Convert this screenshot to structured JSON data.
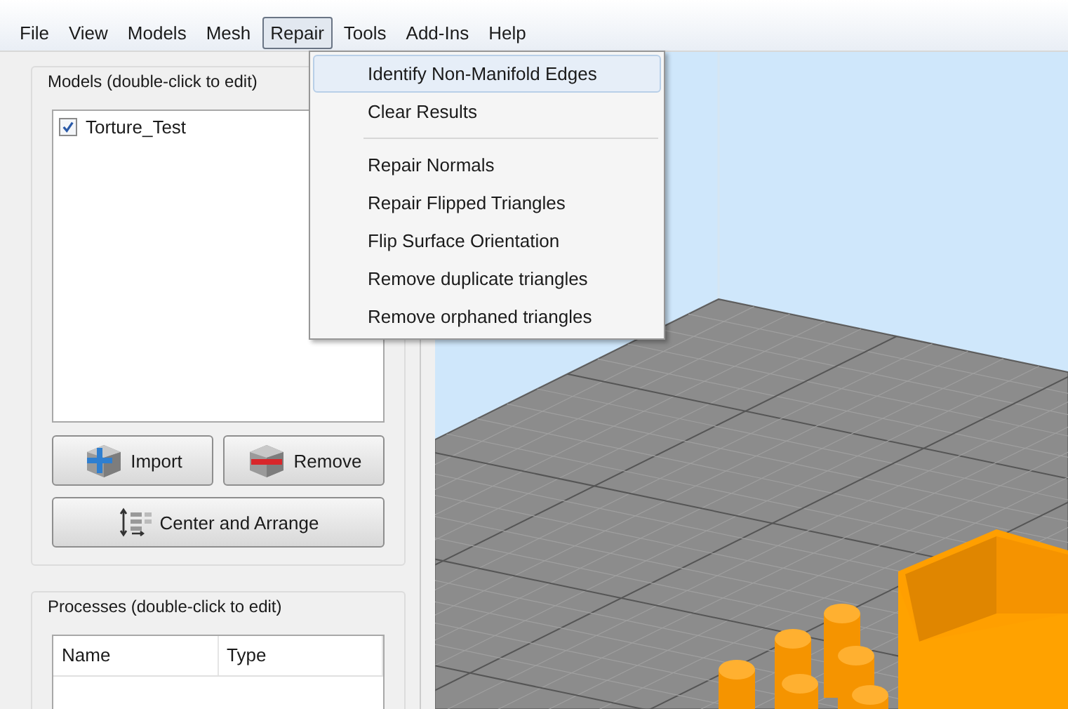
{
  "menu_bar": [
    {
      "label": "File",
      "selected": false
    },
    {
      "label": "View",
      "selected": false
    },
    {
      "label": "Models",
      "selected": false
    },
    {
      "label": "Mesh",
      "selected": false
    },
    {
      "label": "Repair",
      "selected": true
    },
    {
      "label": "Tools",
      "selected": false
    },
    {
      "label": "Add-Ins",
      "selected": false
    },
    {
      "label": "Help",
      "selected": false
    }
  ],
  "repair_menu": {
    "items": [
      {
        "kind": "item",
        "label": "Identify Non-Manifold Edges",
        "highlighted": true
      },
      {
        "kind": "item",
        "label": "Clear Results",
        "highlighted": false
      },
      {
        "kind": "separator"
      },
      {
        "kind": "item",
        "label": "Repair Normals",
        "highlighted": false
      },
      {
        "kind": "item",
        "label": "Repair Flipped Triangles",
        "highlighted": false
      },
      {
        "kind": "item",
        "label": "Flip Surface Orientation",
        "highlighted": false
      },
      {
        "kind": "item",
        "label": "Remove duplicate triangles",
        "highlighted": false
      },
      {
        "kind": "item",
        "label": "Remove orphaned triangles",
        "highlighted": false
      }
    ]
  },
  "models": {
    "title": "Models (double-click to edit)",
    "items": [
      {
        "label": "Torture_Test",
        "checked": true
      }
    ],
    "buttons": [
      {
        "kind": "import",
        "label": "Import"
      },
      {
        "kind": "remove",
        "label": "Remove"
      },
      {
        "kind": "arrange",
        "label": "Center and Arrange"
      }
    ]
  },
  "processes": {
    "title": "Processes (double-click to edit)",
    "columns": [
      "Name",
      "Type"
    ]
  }
}
